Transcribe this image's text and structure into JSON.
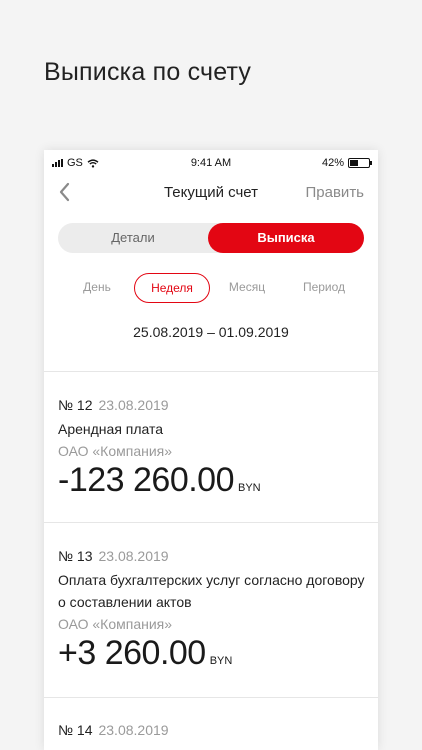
{
  "promo_title": "Выписка по счету",
  "status_bar": {
    "carrier": "GS",
    "time": "9:41 AM",
    "battery": "42%",
    "battery_level": 0.42
  },
  "nav": {
    "title": "Текущий счет",
    "edit_label": "Править"
  },
  "segment": {
    "details_label": "Детали",
    "statement_label": "Выписка",
    "selected": "statement"
  },
  "period_tabs": {
    "day": "День",
    "week": "Неделя",
    "month": "Месяц",
    "period": "Период",
    "selected": "week"
  },
  "date_range": "25.08.2019 – 01.09.2019",
  "transactions": [
    {
      "number": "№ 12",
      "date": "23.08.2019",
      "description": "Арендная плата",
      "company": "ОАО «Компания»",
      "amount": "-123 260.00",
      "currency": "BYN"
    },
    {
      "number": "№ 13",
      "date": "23.08.2019",
      "description": "Оплата бухгалтерских услуг согласно договору о составлении актов",
      "company": "ОАО «Компания»",
      "amount": "+3 260.00",
      "currency": "BYN"
    },
    {
      "number": "№ 14",
      "date": "23.08.2019"
    }
  ]
}
